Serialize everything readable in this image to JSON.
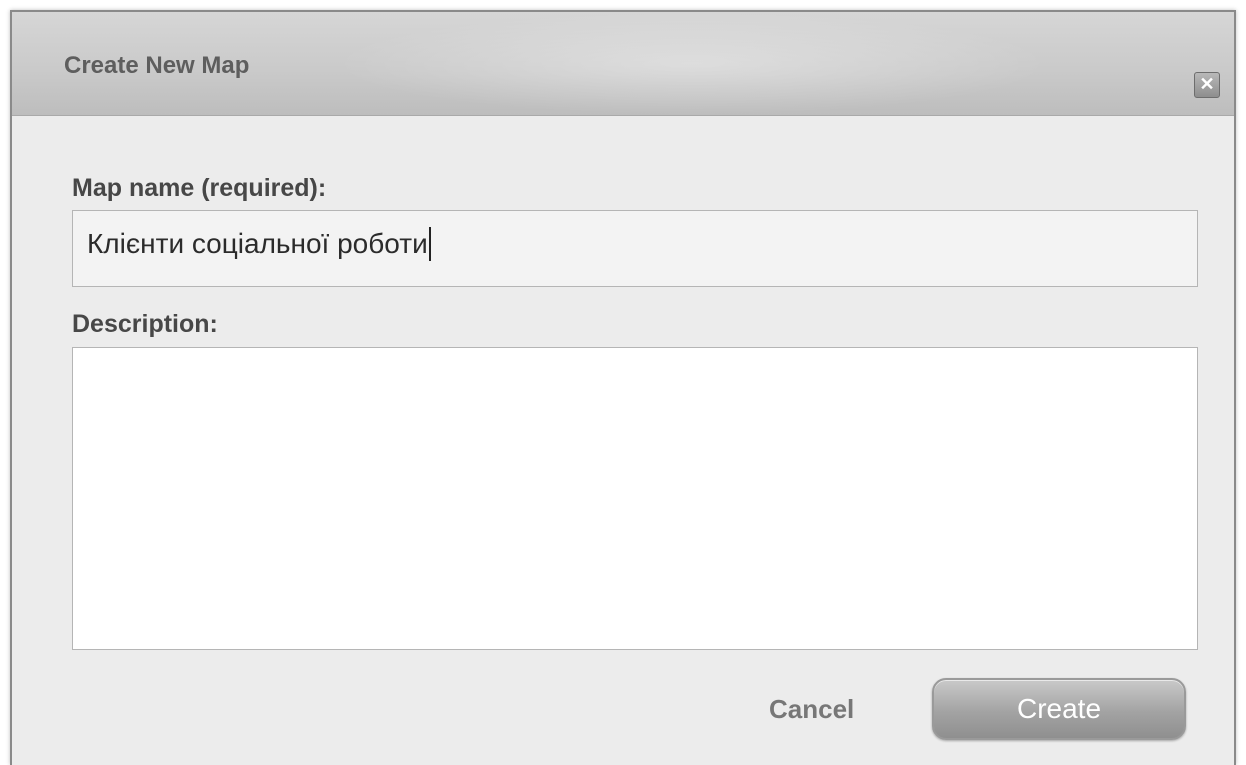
{
  "dialog": {
    "title": "Create New Map",
    "close_icon": "close-icon",
    "close_glyph": "✕"
  },
  "form": {
    "name_label": "Map name (required):",
    "name_value": "Клієнти соціальної роботи",
    "description_label": "Description:",
    "description_value": ""
  },
  "actions": {
    "cancel_label": "Cancel",
    "create_label": "Create"
  },
  "colors": {
    "dialog_bg": "#ececec",
    "titlebar_bg": "#c9c9c9",
    "label_text": "#474747",
    "button_bg": "#a3a3a3"
  }
}
